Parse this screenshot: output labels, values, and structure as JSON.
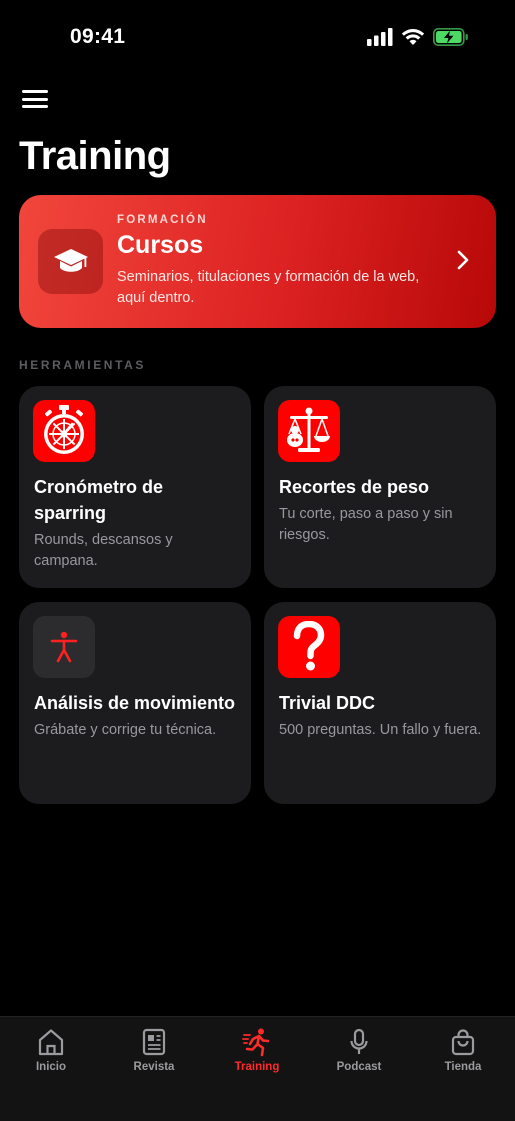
{
  "status_bar": {
    "time": "09:41"
  },
  "header": {
    "title": "Training"
  },
  "hero": {
    "eyebrow": "FORMACIÓN",
    "title": "Cursos",
    "description": "Seminarios, titulaciones y formación de la web, aquí dentro.",
    "icon": "graduation-cap-icon"
  },
  "section": {
    "label": "HERRAMIENTAS"
  },
  "tools": [
    {
      "title": "Cronómetro de sparring",
      "description": "Rounds, descansos y campana.",
      "icon": "stopwatch-icon"
    },
    {
      "title": "Recortes de peso",
      "description": "Tu corte, paso a paso y sin riesgos.",
      "icon": "scale-icon"
    },
    {
      "title": "Análisis de movimiento",
      "description": "Grábate y corrige tu técnica.",
      "icon": "figure-icon"
    },
    {
      "title": "Trivial DDC",
      "description": "500 preguntas. Un fallo y fuera.",
      "icon": "question-mark-icon"
    }
  ],
  "tabbar": {
    "tabs": [
      {
        "label": "Inicio",
        "icon": "home-icon"
      },
      {
        "label": "Revista",
        "icon": "newspaper-icon"
      },
      {
        "label": "Training",
        "icon": "running-figure-icon",
        "active": true
      },
      {
        "label": "Podcast",
        "icon": "microphone-icon"
      },
      {
        "label": "Tienda",
        "icon": "shopping-bag-icon"
      }
    ]
  },
  "colors": {
    "accent": "#ff2a2a",
    "card": "#1c1c1e",
    "background": "#000000"
  }
}
